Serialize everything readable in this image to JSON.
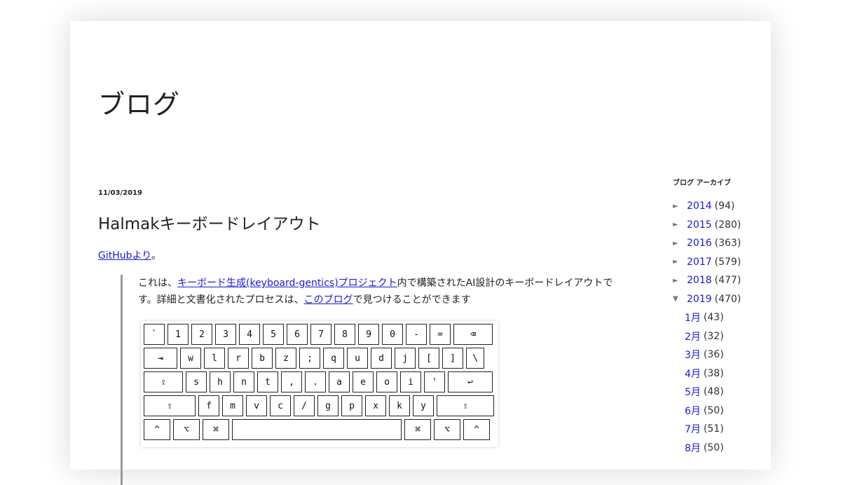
{
  "blog": {
    "title": "ブログ"
  },
  "post": {
    "date": "11/03/2019",
    "title": "Halmakキーボードレイアウト",
    "source_link": "GitHubより",
    "source_suffix": "。",
    "quote": {
      "p1": "これは、",
      "link1": "キーボード生成(keyboard-gentics)プロジェクト",
      "p2": "内で構築されたAI設計のキーボードレイアウトです。詳細と文書化されたプロセスは、",
      "link2": "このブログ",
      "p3": "で見つけることができます"
    }
  },
  "keyboard": {
    "rows": [
      [
        "`",
        "1",
        "2",
        "3",
        "4",
        "5",
        "6",
        "7",
        "8",
        "9",
        "0",
        "-",
        "=",
        "⌫"
      ],
      [
        "⇥",
        "w",
        "l",
        "r",
        "b",
        "z",
        ";",
        "q",
        "u",
        "d",
        "j",
        "[",
        "]",
        "\\"
      ],
      [
        "⇪",
        "s",
        "h",
        "n",
        "t",
        ",",
        ".",
        "a",
        "e",
        "o",
        "i",
        "'",
        "↩"
      ],
      [
        "⇧",
        "f",
        "m",
        "v",
        "c",
        "/",
        "g",
        "p",
        "x",
        "k",
        "y",
        "⇧"
      ],
      [
        "^",
        "⌥",
        "⌘",
        "",
        "⌘",
        "⌥",
        "^"
      ]
    ]
  },
  "sidebar": {
    "title": "ブログ アーカイブ",
    "years": [
      {
        "year": "2014",
        "count": "(94)",
        "open": false
      },
      {
        "year": "2015",
        "count": "(280)",
        "open": false
      },
      {
        "year": "2016",
        "count": "(363)",
        "open": false
      },
      {
        "year": "2017",
        "count": "(579)",
        "open": false
      },
      {
        "year": "2018",
        "count": "(477)",
        "open": false
      },
      {
        "year": "2019",
        "count": "(470)",
        "open": true
      }
    ],
    "months": [
      {
        "month": "1月",
        "count": "(43)"
      },
      {
        "month": "2月",
        "count": "(32)"
      },
      {
        "month": "3月",
        "count": "(36)"
      },
      {
        "month": "4月",
        "count": "(38)"
      },
      {
        "month": "5月",
        "count": "(48)"
      },
      {
        "month": "6月",
        "count": "(50)"
      },
      {
        "month": "7月",
        "count": "(51)"
      },
      {
        "month": "8月",
        "count": "(50)"
      }
    ],
    "collapsed_icon": "►",
    "expanded_icon": "▼"
  }
}
